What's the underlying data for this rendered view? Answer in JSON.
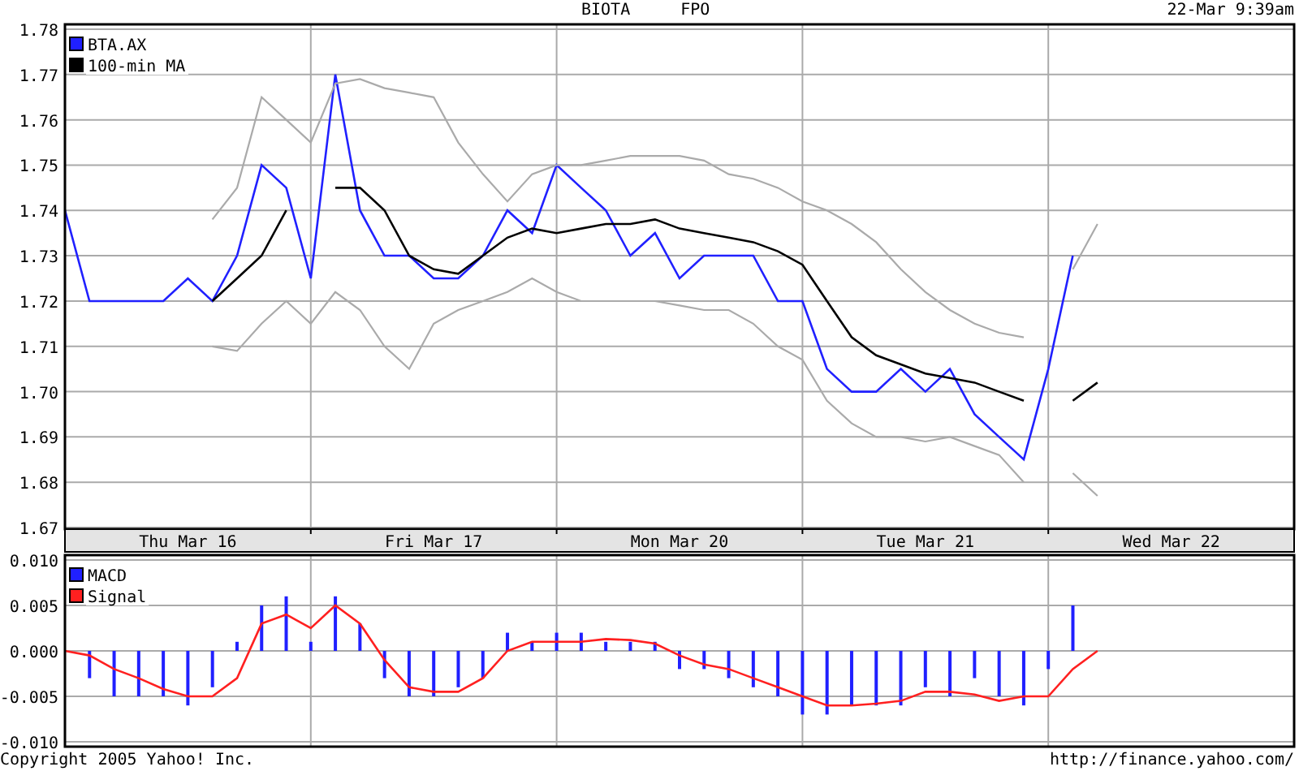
{
  "header": {
    "symbol": "BIOTA",
    "security_class": "FPO",
    "timestamp": "22-Mar 9:39am"
  },
  "price_chart": {
    "chart_data": {
      "type": "line",
      "categories": [
        null,
        null,
        null,
        null,
        null,
        "Thu Mar 16",
        null,
        null,
        null,
        null,
        null,
        null,
        null,
        null,
        null,
        "Fri Mar 17",
        null,
        null,
        null,
        null,
        null,
        null,
        null,
        null,
        null,
        "Mon Mar 20",
        null,
        null,
        null,
        null,
        null,
        null,
        null,
        null,
        null,
        "Tue Mar 21",
        null,
        null,
        null,
        null,
        null,
        null,
        null,
        null,
        null,
        "Wed Mar 22",
        null,
        null,
        null,
        null,
        null
      ],
      "series": [
        {
          "name": "BTA.AX",
          "color": "#2020ff",
          "values": [
            1.74,
            1.72,
            1.72,
            1.72,
            1.72,
            1.725,
            1.72,
            1.73,
            1.75,
            1.745,
            1.725,
            1.77,
            1.74,
            1.73,
            1.73,
            1.725,
            1.725,
            1.73,
            1.74,
            1.735,
            1.75,
            1.745,
            1.74,
            1.73,
            1.735,
            1.725,
            1.73,
            1.73,
            1.73,
            1.72,
            1.72,
            1.705,
            1.7,
            1.7,
            1.705,
            1.7,
            1.705,
            1.695,
            1.69,
            1.685,
            1.705,
            1.73,
            null,
            null,
            null,
            null,
            null,
            null,
            null,
            null,
            null
          ]
        },
        {
          "name": "100-min MA",
          "color": "#000000",
          "values": [
            null,
            null,
            null,
            null,
            null,
            null,
            1.72,
            1.725,
            1.73,
            1.74,
            null,
            1.745,
            1.745,
            1.74,
            1.73,
            1.727,
            1.726,
            1.73,
            1.734,
            1.736,
            1.735,
            1.736,
            1.737,
            1.737,
            1.738,
            1.736,
            1.735,
            1.734,
            1.733,
            1.731,
            1.728,
            1.72,
            1.712,
            1.708,
            1.706,
            1.704,
            1.703,
            1.702,
            1.7,
            1.698,
            null,
            1.698,
            1.702,
            null,
            null,
            null,
            null,
            null,
            null,
            null,
            null
          ]
        },
        {
          "color": "#aaaaaa",
          "values": [
            null,
            null,
            null,
            null,
            null,
            null,
            1.738,
            1.745,
            1.765,
            1.76,
            1.755,
            1.768,
            1.769,
            1.767,
            1.766,
            1.765,
            1.755,
            1.748,
            1.742,
            1.748,
            1.75,
            1.75,
            1.751,
            1.752,
            1.752,
            1.752,
            1.751,
            1.748,
            1.747,
            1.745,
            1.742,
            1.74,
            1.737,
            1.733,
            1.727,
            1.722,
            1.718,
            1.715,
            1.713,
            1.712,
            null,
            1.727,
            1.737,
            null,
            null,
            null,
            null,
            null,
            null,
            null,
            null
          ]
        },
        {
          "color": "#aaaaaa",
          "values": [
            null,
            null,
            null,
            null,
            null,
            null,
            1.71,
            1.709,
            1.715,
            1.72,
            1.715,
            1.722,
            1.718,
            1.71,
            1.705,
            1.715,
            1.718,
            1.72,
            1.722,
            1.725,
            1.722,
            1.72,
            1.72,
            1.72,
            1.72,
            1.719,
            1.718,
            1.718,
            1.715,
            1.71,
            1.707,
            1.698,
            1.693,
            1.69,
            1.69,
            1.689,
            1.69,
            1.688,
            1.686,
            1.68,
            null,
            1.682,
            1.677,
            null,
            null,
            null,
            null,
            null,
            null,
            null,
            null
          ]
        }
      ],
      "ylim": [
        1.67,
        1.78
      ],
      "grid": true,
      "legend": "upper left",
      "yticks": [
        {
          "value": 1.67,
          "label": "1.67"
        },
        {
          "value": 1.68,
          "label": "1.68"
        },
        {
          "value": 1.69,
          "label": "1.69"
        },
        {
          "value": 1.7,
          "label": "1.70"
        },
        {
          "value": 1.71,
          "label": "1.71"
        },
        {
          "value": 1.72,
          "label": "1.72"
        },
        {
          "value": 1.73,
          "label": "1.73"
        },
        {
          "value": 1.74,
          "label": "1.74"
        },
        {
          "value": 1.75,
          "label": "1.75"
        },
        {
          "value": 1.76,
          "label": "1.76"
        },
        {
          "value": 1.77,
          "label": "1.77"
        },
        {
          "value": 1.78,
          "label": "1.78"
        }
      ]
    }
  },
  "macd_chart": {
    "chart_data": {
      "type": "bar",
      "categories": [
        null,
        null,
        null,
        null,
        null,
        null,
        null,
        null,
        null,
        null,
        null,
        null,
        null,
        null,
        null,
        null,
        null,
        null,
        null,
        null,
        null,
        null,
        null,
        null,
        null,
        null,
        null,
        null,
        null,
        null,
        null,
        null,
        null,
        null,
        null,
        null,
        null,
        null,
        null,
        null,
        null,
        null,
        null,
        null,
        null,
        null,
        null,
        null,
        null,
        null,
        null
      ],
      "series": [
        {
          "name": "MACD",
          "color": "#2020ff",
          "values": [
            0,
            -0.003,
            -0.005,
            -0.005,
            -0.005,
            -0.006,
            -0.004,
            0.001,
            0.005,
            0.006,
            0.001,
            0.006,
            0.003,
            -0.003,
            -0.005,
            -0.005,
            -0.004,
            -0.003,
            0.002,
            0.001,
            0.002,
            0.002,
            0.001,
            0.001,
            0.001,
            -0.002,
            -0.002,
            -0.003,
            -0.004,
            -0.005,
            -0.007,
            -0.007,
            -0.006,
            -0.006,
            -0.006,
            -0.004,
            -0.005,
            -0.003,
            -0.005,
            -0.006,
            -0.002,
            0.005,
            null,
            null,
            null,
            null,
            null,
            null,
            null,
            null,
            null
          ]
        },
        {
          "name": "Signal",
          "type": "line",
          "color": "#ff2020",
          "values": [
            0,
            -0.0005,
            -0.002,
            -0.003,
            -0.0042,
            -0.005,
            -0.005,
            -0.003,
            0.003,
            0.004,
            0.0025,
            0.005,
            0.003,
            -0.001,
            -0.004,
            -0.0045,
            -0.0045,
            -0.003,
            0,
            0.001,
            0.001,
            0.001,
            0.0013,
            0.0012,
            0.0008,
            -0.0005,
            -0.0015,
            -0.002,
            -0.003,
            -0.004,
            -0.005,
            -0.006,
            -0.006,
            -0.0058,
            -0.0055,
            -0.0045,
            -0.0045,
            -0.0048,
            -0.0055,
            -0.005,
            -0.005,
            -0.002,
            0,
            null,
            null,
            null,
            null,
            null,
            null,
            null,
            null
          ]
        }
      ],
      "ylim": [
        -0.01,
        0.01
      ],
      "grid": true,
      "legend": "upper left",
      "yticks": [
        {
          "value": 0.01,
          "label": "0.010"
        },
        {
          "value": 0.005,
          "label": "0.005"
        },
        {
          "value": 0,
          "label": "0.000"
        },
        {
          "value": -0.005,
          "label": "-0.005"
        },
        {
          "value": -0.01,
          "label": "-0.010"
        }
      ]
    }
  },
  "footer": {
    "copyright": "Copyright 2005 Yahoo! Inc.",
    "url": "http://finance.yahoo.com/"
  }
}
